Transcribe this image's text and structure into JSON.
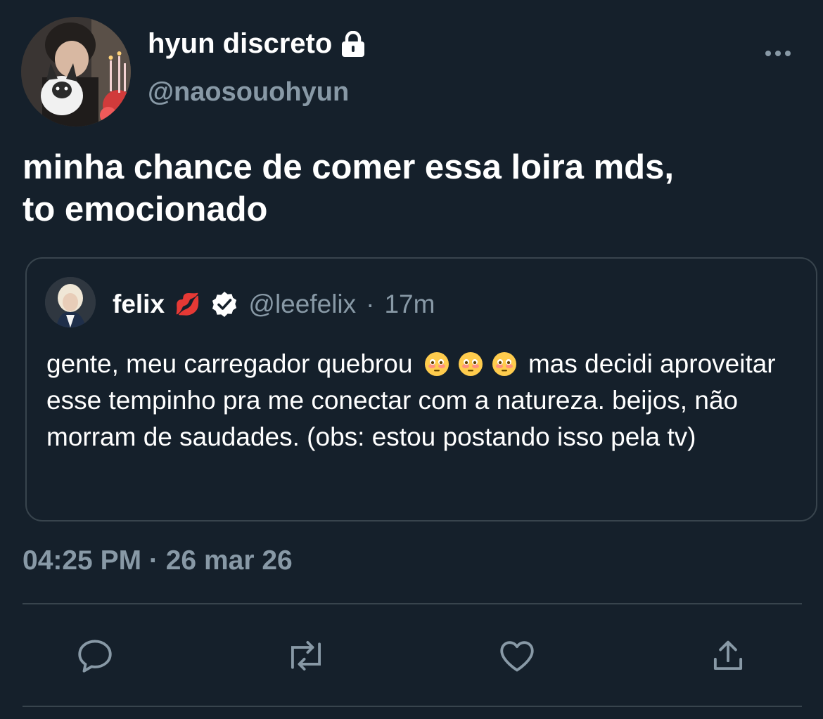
{
  "tweet": {
    "display_name": "hyun discreto",
    "handle": "@naosouohyun",
    "text": "minha chance de comer essa loira mds,\nto emocionado",
    "timestamp": "04:25 PM · 26 mar 26",
    "icons": {
      "lock": "lock-icon",
      "more": "more-icon"
    }
  },
  "quote": {
    "name": "felix",
    "name_emoji": "💋",
    "handle": "@leefelix",
    "separator": "·",
    "time": "17m",
    "body_part1": "gente, meu carregador quebrou",
    "emoji": "😳",
    "body_part2": "mas decidi aproveitar esse tempinho pra me conectar com a natureza. beijos, não morram de saudades. (obs: estou postando isso pela tv)"
  },
  "actions": [
    "reply-icon",
    "retweet-icon",
    "like-icon",
    "share-icon"
  ],
  "colors": {
    "background": "#15202b",
    "text": "#ffffff",
    "secondary_text": "#8899a6",
    "border": "#38444d",
    "verified": "#ffffff"
  }
}
